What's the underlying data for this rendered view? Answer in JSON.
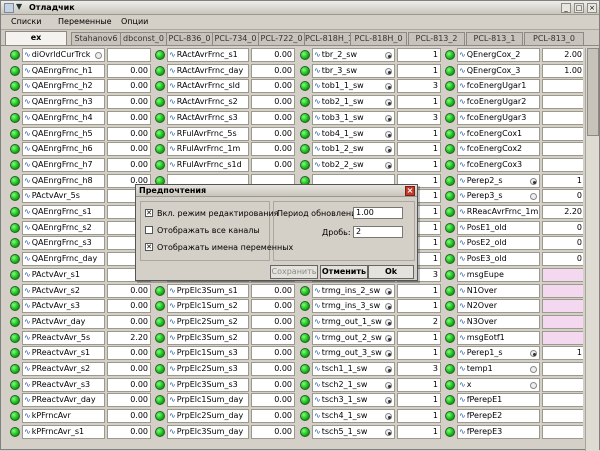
{
  "window": {
    "title": "Отладчик",
    "minimize": "_",
    "maximize": "□",
    "close": "×"
  },
  "menu": [
    "Списки",
    "Переменные",
    "Опции"
  ],
  "tabs": [
    "ex",
    "Stahanov6",
    "dbconst_0",
    "PCL-836_0",
    "PCL-734_0",
    "PCL-722_0",
    "PCL-818H_1",
    "PCL-818H_0",
    "PCL-813_2",
    "PCL-813_1",
    "PCL-813_0"
  ],
  "active_tab": "ex",
  "columns": [
    [
      {
        "name": "diOvrldCurTrck",
        "value": "",
        "radio": "empty",
        "pink": false
      },
      {
        "name": "QAEnrgFrnc_h1",
        "value": "0.00"
      },
      {
        "name": "QAEnrgFrnc_h2",
        "value": "0.00"
      },
      {
        "name": "QAEnrgFrnc_h3",
        "value": "0.00"
      },
      {
        "name": "QAEnrgFrnc_h4",
        "value": "0.00"
      },
      {
        "name": "QAEnrgFrnc_h5",
        "value": "0.00"
      },
      {
        "name": "QAEnrgFrnc_h6",
        "value": "0.00"
      },
      {
        "name": "QAEnrgFrnc_h7",
        "value": "0.00"
      },
      {
        "name": "QAEnrgFrnc_h8",
        "value": "0.00"
      },
      {
        "name": "PActvAvr_5s",
        "value": ""
      },
      {
        "name": "QAEnrgFrnc_s1",
        "value": ""
      },
      {
        "name": "QAEnrgFrnc_s2",
        "value": ""
      },
      {
        "name": "QAEnrgFrnc_s3",
        "value": ""
      },
      {
        "name": "QAEnrgFrnc_day",
        "value": ""
      },
      {
        "name": "PActvAvr_s1",
        "value": ""
      },
      {
        "name": "PActvAvr_s2",
        "value": "0.00"
      },
      {
        "name": "PActvAvr_s3",
        "value": "0.00"
      },
      {
        "name": "PActvAvr_day",
        "value": "0.00"
      },
      {
        "name": "PReactvAvr_5s",
        "value": "2.20"
      },
      {
        "name": "PReactvAvr_s1",
        "value": "0.00"
      },
      {
        "name": "PReactvAvr_s2",
        "value": "0.00"
      },
      {
        "name": "PReactvAvr_s3",
        "value": "0.00"
      },
      {
        "name": "PReactvAvr_day",
        "value": "0.00"
      },
      {
        "name": "kPFrncAvr",
        "value": "0.00"
      },
      {
        "name": "kPFrncAvr_s1",
        "value": "0.00"
      }
    ],
    [
      {
        "name": "RActAvrFrnc_s1",
        "value": "0.00"
      },
      {
        "name": "RActAvrFrnc_day",
        "value": "0.00"
      },
      {
        "name": "RActAvrFrnc_sld",
        "value": "0.00"
      },
      {
        "name": "RActAvrFrnc_s2",
        "value": "0.00"
      },
      {
        "name": "RActAvrFrnc_s3",
        "value": "0.00"
      },
      {
        "name": "RFulAvrFrnc_5s",
        "value": "0.00"
      },
      {
        "name": "RFulAvrFrnc_1m",
        "value": "0.00"
      },
      {
        "name": "RFulAvrFrnc_s1d",
        "value": "0.00"
      },
      {
        "name": "",
        "value": ""
      },
      {
        "name": "",
        "value": ""
      },
      {
        "name": "",
        "value": ""
      },
      {
        "name": "",
        "value": ""
      },
      {
        "name": "",
        "value": ""
      },
      {
        "name": "",
        "value": ""
      },
      {
        "name": "",
        "value": ""
      },
      {
        "name": "PrpElc3Sum_s1",
        "value": "0.00"
      },
      {
        "name": "PrpElc1Sum_s2",
        "value": "0.00"
      },
      {
        "name": "PrpElc2Sum_s2",
        "value": "0.00"
      },
      {
        "name": "PrpElc3Sum_s2",
        "value": "0.00"
      },
      {
        "name": "PrpElc1Sum_s3",
        "value": "0.00"
      },
      {
        "name": "PrpElc2Sum_s3",
        "value": "0.00"
      },
      {
        "name": "PrpElc3Sum_s3",
        "value": "0.00"
      },
      {
        "name": "PrpElc1Sum_day",
        "value": "0.00"
      },
      {
        "name": "PrpElc2Sum_day",
        "value": "0.00"
      },
      {
        "name": "PrpElc3Sum_day",
        "value": "0.00"
      }
    ],
    [
      {
        "name": "tbr_2_sw",
        "value": "1",
        "radio": "filled"
      },
      {
        "name": "tbr_3_sw",
        "value": "1",
        "radio": "filled"
      },
      {
        "name": "tob1_1_sw",
        "value": "3",
        "radio": "filled"
      },
      {
        "name": "tob2_1_sw",
        "value": "1",
        "radio": "filled"
      },
      {
        "name": "tob3_1_sw",
        "value": "3",
        "radio": "filled"
      },
      {
        "name": "tob4_1_sw",
        "value": "1",
        "radio": "filled"
      },
      {
        "name": "tob1_2_sw",
        "value": "1",
        "radio": "filled"
      },
      {
        "name": "tob2_2_sw",
        "value": "1",
        "radio": "filled"
      },
      {
        "name": "",
        "value": "1"
      },
      {
        "name": "",
        "value": "1"
      },
      {
        "name": "",
        "value": "1"
      },
      {
        "name": "",
        "value": "1"
      },
      {
        "name": "",
        "value": "1"
      },
      {
        "name": "",
        "value": "1"
      },
      {
        "name": "",
        "value": "3"
      },
      {
        "name": "trmg_ins_2_sw",
        "value": "1",
        "radio": "filled"
      },
      {
        "name": "trmg_ins_3_sw",
        "value": "1",
        "radio": "filled"
      },
      {
        "name": "trmg_out_1_sw",
        "value": "2",
        "radio": "filled"
      },
      {
        "name": "trmg_out_2_sw",
        "value": "1",
        "radio": "filled"
      },
      {
        "name": "trmg_out_3_sw",
        "value": "1",
        "radio": "filled"
      },
      {
        "name": "tsch1_1_sw",
        "value": "3",
        "radio": "filled"
      },
      {
        "name": "tsch2_1_sw",
        "value": "1",
        "radio": "filled"
      },
      {
        "name": "tsch3_1_sw",
        "value": "1",
        "radio": "filled"
      },
      {
        "name": "tsch4_1_sw",
        "value": "1",
        "radio": "filled"
      },
      {
        "name": "tsch5_1_sw",
        "value": "1",
        "radio": "filled"
      }
    ],
    [
      {
        "name": "QEnergCox_2",
        "value": "2.00"
      },
      {
        "name": "QEnergCox_3",
        "value": "1.00"
      },
      {
        "name": "fcoEnergUgar1",
        "value": ""
      },
      {
        "name": "fcoEnergUgar2",
        "value": ""
      },
      {
        "name": "fcoEnergUgar3",
        "value": ""
      },
      {
        "name": "fcoEnergCox1",
        "value": ""
      },
      {
        "name": "fcoEnergCox2",
        "value": ""
      },
      {
        "name": "fcoEnergCox3",
        "value": ""
      },
      {
        "name": "Perep2_s",
        "value": "1",
        "radio": "filled"
      },
      {
        "name": "Perep3_s",
        "value": "0",
        "radio": "empty"
      },
      {
        "name": "RReacAvrFrnc_1m",
        "value": "2.20"
      },
      {
        "name": "PosE1_old",
        "value": "0"
      },
      {
        "name": "PosE2_old",
        "value": "0"
      },
      {
        "name": "PosE3_old",
        "value": "0"
      },
      {
        "name": "msgEupe",
        "value": "",
        "pink": true
      },
      {
        "name": "N1Over",
        "value": "",
        "pink": true
      },
      {
        "name": "N2Over",
        "value": "",
        "pink": true
      },
      {
        "name": "N3Over",
        "value": "",
        "pink": true
      },
      {
        "name": "msgEotf1",
        "value": "",
        "pink": true
      },
      {
        "name": "Perep1_s",
        "value": "1",
        "radio": "filled"
      },
      {
        "name": "temp1",
        "value": "",
        "radio": "empty"
      },
      {
        "name": "x",
        "value": "",
        "radio": "empty"
      },
      {
        "name": "fPerepE1",
        "value": ""
      },
      {
        "name": "fPerepE2",
        "value": ""
      },
      {
        "name": "fPerepE3",
        "value": ""
      }
    ]
  ],
  "dialog": {
    "title": "Предпочтения",
    "close": "×",
    "cb_edit": "Вкл. режим редактирования",
    "cb_edit_checked": true,
    "cb_channels": "Отображать все каналы",
    "cb_channels_checked": false,
    "cb_varnames": "Отображать имена переменных",
    "cb_varnames_checked": true,
    "period_label": "Период обновления:",
    "period_value": "1.00",
    "fraction_label": "Дробь:",
    "fraction_value": "2",
    "save": "Сохранить",
    "cancel": "Отменить",
    "ok": "Ok"
  },
  "icons": {
    "row_icon": "signal-icon",
    "check": "✕"
  }
}
